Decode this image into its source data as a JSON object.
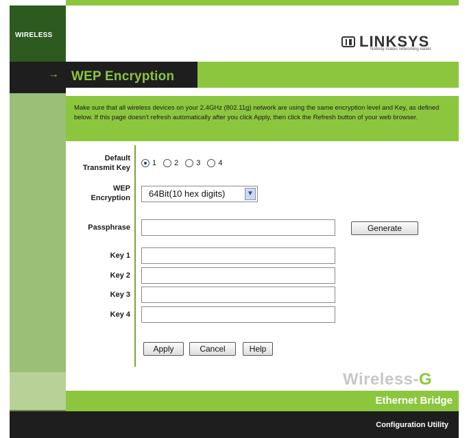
{
  "sidebar": {
    "section_label": "WIRELESS"
  },
  "brand": {
    "name": "LINKSYS",
    "tagline": "Nobody makes networking easier."
  },
  "page": {
    "title": "WEP Encryption"
  },
  "description": "Make sure that all wireless devices on your 2.4GHz (802.11g) network are using the same encryption level and Key, as defined below. If this page doesn't refresh automatically after you click Apply, then click the Refresh button of your web browser.",
  "form": {
    "default_key_label_1": "Default",
    "default_key_label_2": "Transmit Key",
    "transmit_key_options": [
      "1",
      "2",
      "3",
      "4"
    ],
    "transmit_key_selected": "1",
    "wep_label_1": "WEP",
    "wep_label_2": "Encryption",
    "wep_selected": "64Bit(10 hex digits)",
    "passphrase_label": "Passphrase",
    "passphrase_value": "",
    "generate_label": "Generate",
    "keys": [
      {
        "label": "Key 1",
        "value": ""
      },
      {
        "label": "Key 2",
        "value": ""
      },
      {
        "label": "Key 3",
        "value": ""
      },
      {
        "label": "Key 4",
        "value": ""
      }
    ],
    "apply_label": "Apply",
    "cancel_label": "Cancel",
    "help_label": "Help"
  },
  "footer": {
    "product_a": "Wireless-",
    "product_b": "G",
    "product_line": "Ethernet Bridge",
    "utility": "Configuration Utility"
  },
  "colors": {
    "accent": "#8cc63f",
    "dark": "#1e1e1e"
  }
}
